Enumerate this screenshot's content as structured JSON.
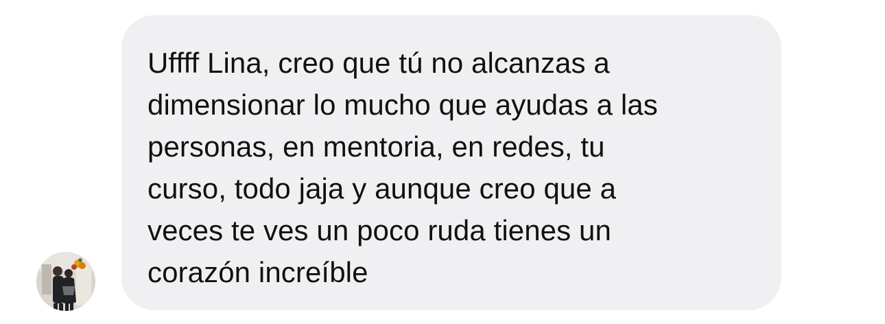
{
  "message": {
    "sender_avatar_icon": "profile-photo-avatar",
    "lines": [
      "Uffff Lina, creo que tú no alcanzas a",
      "dimensionar lo mucho que ayudas a las",
      "personas, en mentoria, en redes, tu",
      "curso, todo jaja y aunque creo que a",
      "veces te ves un poco ruda tienes un",
      "corazón increíble"
    ]
  },
  "colors": {
    "bubble_background": "#f0f0f2",
    "text": "#111111",
    "page_background": "#ffffff"
  }
}
